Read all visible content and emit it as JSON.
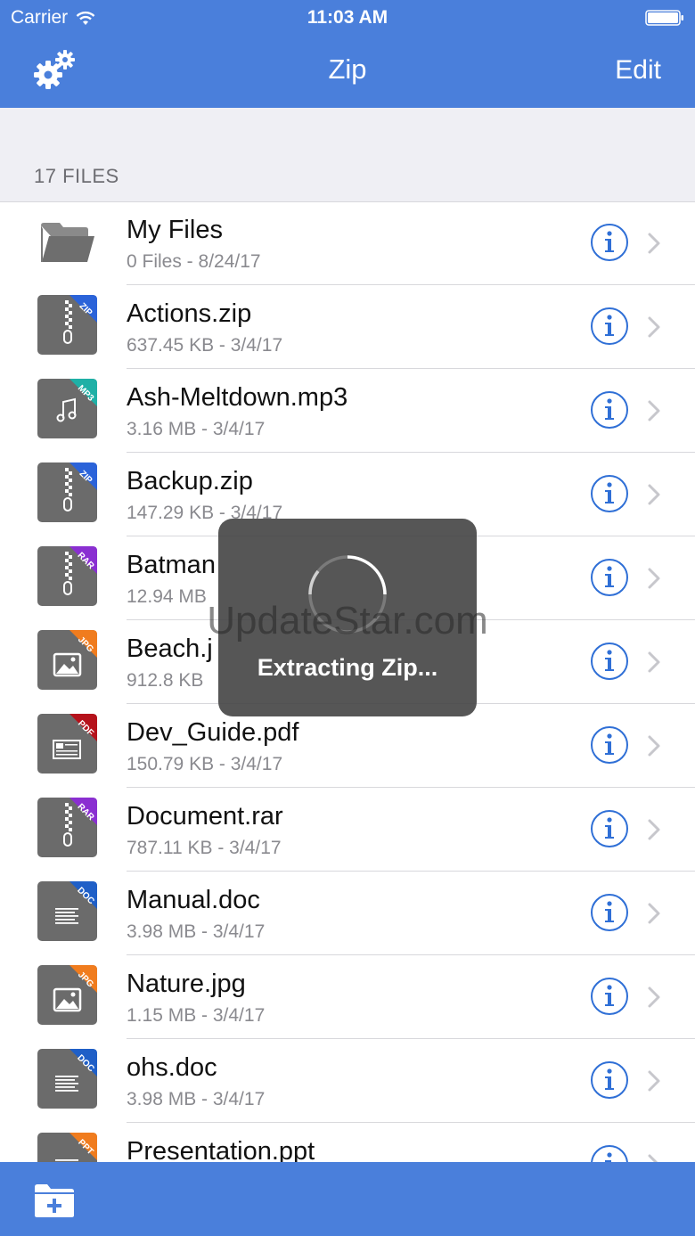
{
  "status_bar": {
    "carrier": "Carrier",
    "time": "11:03 AM"
  },
  "nav": {
    "title": "Zip",
    "edit_label": "Edit",
    "settings_icon": "gears-icon"
  },
  "section": {
    "title": "17 FILES"
  },
  "files": [
    {
      "name": "My Files",
      "meta": "0 Files - 8/24/17",
      "type": "folder"
    },
    {
      "name": "Actions.zip",
      "meta": "637.45 KB - 3/4/17",
      "type": "zip",
      "badge": "ZIP",
      "badge_color": "#2b63d9"
    },
    {
      "name": "Ash-Meltdown.mp3",
      "meta": "3.16 MB - 3/4/17",
      "type": "mp3",
      "badge": "MP3",
      "badge_color": "#1fb0a6"
    },
    {
      "name": "Backup.zip",
      "meta": "147.29 KB - 3/4/17",
      "type": "zip",
      "badge": "ZIP",
      "badge_color": "#2b63d9"
    },
    {
      "name": "Batman",
      "meta": "12.94 MB",
      "type": "rar",
      "badge": "RAR",
      "badge_color": "#8a2fd1"
    },
    {
      "name": "Beach.j",
      "meta": "912.8 KB",
      "type": "jpg",
      "badge": "JPG",
      "badge_color": "#f07c1e"
    },
    {
      "name": "Dev_Guide.pdf",
      "meta": "150.79 KB - 3/4/17",
      "type": "pdf",
      "badge": "PDF",
      "badge_color": "#b5121b"
    },
    {
      "name": "Document.rar",
      "meta": "787.11 KB - 3/4/17",
      "type": "rar",
      "badge": "RAR",
      "badge_color": "#8a2fd1"
    },
    {
      "name": "Manual.doc",
      "meta": "3.98 MB - 3/4/17",
      "type": "doc",
      "badge": "DOC",
      "badge_color": "#1f5fc7"
    },
    {
      "name": "Nature.jpg",
      "meta": "1.15 MB - 3/4/17",
      "type": "jpg",
      "badge": "JPG",
      "badge_color": "#f07c1e"
    },
    {
      "name": "ohs.doc",
      "meta": "3.98 MB - 3/4/17",
      "type": "doc",
      "badge": "DOC",
      "badge_color": "#1f5fc7"
    },
    {
      "name": "Presentation.ppt",
      "meta": "",
      "type": "ppt",
      "badge": "PPT",
      "badge_color": "#f07c1e"
    }
  ],
  "hud": {
    "label": "Extracting Zip..."
  },
  "watermark": "UpdateStar.com",
  "colors": {
    "accent": "#4a7fdb",
    "info_icon": "#2f6fd6",
    "file_tile": "#6b6b6b"
  }
}
